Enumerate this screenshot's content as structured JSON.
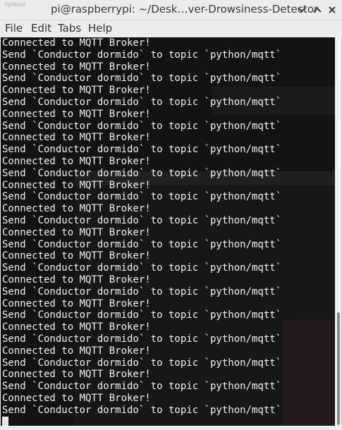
{
  "titlebar": {
    "background_tab_label": "Aplazar",
    "title": "pi@raspberrypi: ~/Desk…ver-Drowsiness-Detector"
  },
  "menu": {
    "items": [
      {
        "label": "File"
      },
      {
        "label": "Edit"
      },
      {
        "label": "Tabs"
      },
      {
        "label": "Help"
      }
    ]
  },
  "terminal": {
    "lines": [
      "Connected to MQTT Broker!",
      "Send `Conductor dormido` to topic `python/mqtt`",
      "Connected to MQTT Broker!",
      "Send `Conductor dormido` to topic `python/mqtt`",
      "Connected to MQTT Broker!",
      "Send `Conductor dormido` to topic `python/mqtt`",
      "Connected to MQTT Broker!",
      "Send `Conductor dormido` to topic `python/mqtt`",
      "Connected to MQTT Broker!",
      "Send `Conductor dormido` to topic `python/mqtt`",
      "Connected to MQTT Broker!",
      "Send `Conductor dormido` to topic `python/mqtt`",
      "Connected to MQTT Broker!",
      "Send `Conductor dormido` to topic `python/mqtt`",
      "Connected to MQTT Broker!",
      "Send `Conductor dormido` to topic `python/mqtt`",
      "Connected to MQTT Broker!",
      "Send `Conductor dormido` to topic `python/mqtt`",
      "Connected to MQTT Broker!",
      "Send `Conductor dormido` to topic `python/mqtt`",
      "Connected to MQTT Broker!",
      "Send `Conductor dormido` to topic `python/mqtt`",
      "Connected to MQTT Broker!",
      "Send `Conductor dormido` to topic `python/mqtt`",
      "Connected to MQTT Broker!",
      "Send `Conductor dormido` to topic `python/mqtt`",
      "Connected to MQTT Broker!",
      "Send `Conductor dormido` to topic `python/mqtt`",
      "Connected to MQTT Broker!",
      "Send `Conductor dormido` to topic `python/mqtt`",
      "Connected to MQTT Broker!",
      "Send `Conductor dormido` to topic `python/mqtt`"
    ],
    "colors": {
      "background": "#131313",
      "text": "#f2f2f2"
    }
  },
  "icons": {
    "chevron": "chevron-down-icon",
    "collapse": "chevron-up-icon",
    "close": "close-icon"
  }
}
